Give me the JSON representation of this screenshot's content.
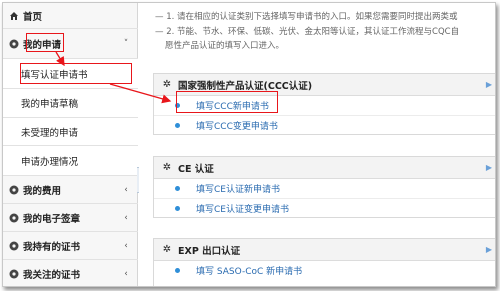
{
  "sidebar": {
    "items": [
      {
        "label": "首页",
        "icon": "home-icon"
      },
      {
        "label": "我的申请",
        "icon": "gear-icon",
        "chevron": "˅"
      },
      {
        "label": "填写认证申请书"
      },
      {
        "label": "我的申请草稿"
      },
      {
        "label": "未受理的申请"
      },
      {
        "label": "申请办理情况"
      },
      {
        "label": "我的费用",
        "icon": "gear-icon",
        "chevron": "‹"
      },
      {
        "label": "我的电子签章",
        "icon": "gear-icon",
        "chevron": "‹"
      },
      {
        "label": "我持有的证书",
        "icon": "gear-icon",
        "chevron": "‹"
      },
      {
        "label": "我关注的证书",
        "icon": "gear-icon",
        "chevron": "‹"
      }
    ],
    "collapse_glyph": "«"
  },
  "notes": {
    "line1": "— 1. 请在相应的认证类别下选择填写申请书的入口。如果您需要同时提出两类或",
    "line2": "— 2. 节能、节水、环保、低碳、光伏、金太阳等认证，其认证工作流程与CQC自",
    "line3": "愿性产品认证的填写入口进入。"
  },
  "panels": [
    {
      "title": "国家强制性产品认证(CCC认证)",
      "links": [
        "填写CCC新申请书",
        "填写CCC变更申请书"
      ]
    },
    {
      "title": "CE 认证",
      "links": [
        "填写CE认证新申请书",
        "填写CE认证变更申请书"
      ]
    },
    {
      "title": "EXP 出口认证",
      "links": [
        "填写 SASO-CoC 新申请书"
      ]
    }
  ],
  "colors": {
    "link": "#2a6bb0",
    "annotation": "#e8161b",
    "bullet": "#2f8fd8"
  }
}
